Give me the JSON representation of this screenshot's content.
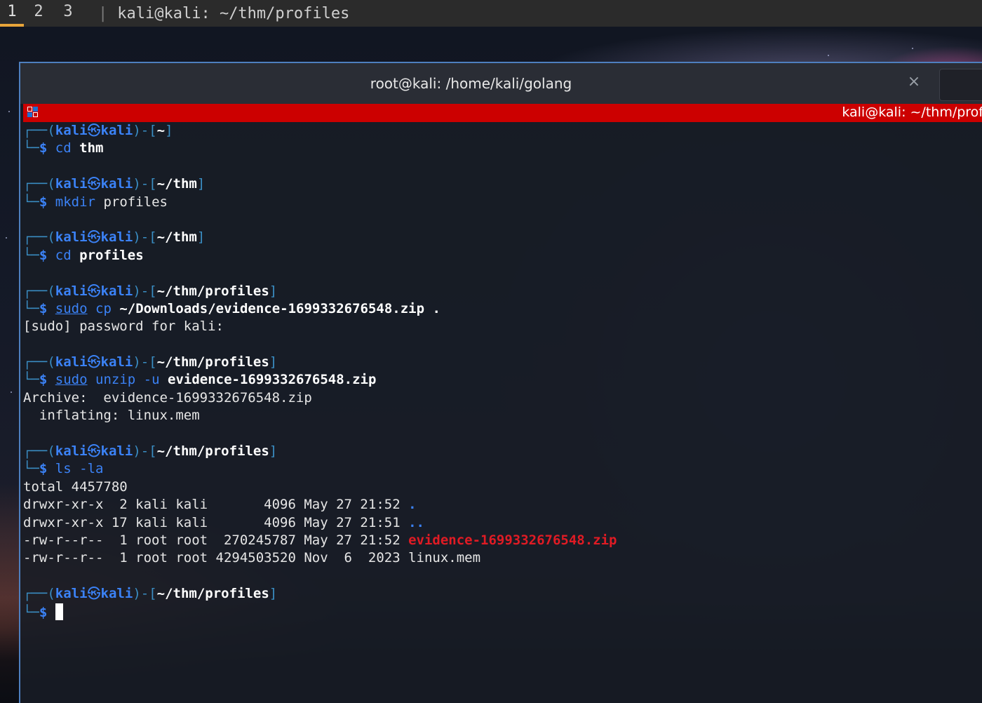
{
  "topbar": {
    "workspaces": [
      "1",
      "2",
      "3"
    ],
    "separator": "|",
    "title": "kali@kali: ~/thm/profiles"
  },
  "window": {
    "title": "root@kali: /home/kali/golang",
    "close_glyph": "×",
    "tab_label": "kali@kali: ~/thm/prof",
    "tab_color": "#cc0000"
  },
  "prompt": {
    "top_left": "┌──(",
    "user": "kali",
    "skull": "㉿",
    "host": "kali",
    "mid": ")-[",
    "close": "]",
    "bottom_left": "└─",
    "dollar": "$"
  },
  "blocks": [
    {
      "path": "~",
      "cmd": [
        {
          "t": "cd",
          "c": "cmd"
        },
        {
          "t": " "
        },
        {
          "t": "thm",
          "c": "arg"
        }
      ],
      "output": []
    },
    {
      "path": "~/thm",
      "cmd": [
        {
          "t": "mkdir",
          "c": "cmd"
        },
        {
          "t": " profiles",
          "c": "out"
        }
      ],
      "output": []
    },
    {
      "path": "~/thm",
      "cmd": [
        {
          "t": "cd",
          "c": "cmd"
        },
        {
          "t": " "
        },
        {
          "t": "profiles",
          "c": "arg"
        }
      ],
      "output": []
    },
    {
      "path": "~/thm/profiles",
      "cmd": [
        {
          "t": "sudo",
          "c": "sudo"
        },
        {
          "t": " "
        },
        {
          "t": "cp",
          "c": "cmd"
        },
        {
          "t": " "
        },
        {
          "t": "~/Downloads/evidence-1699332676548.zip .",
          "c": "arg"
        }
      ],
      "output": [
        "[sudo] password for kali:"
      ]
    },
    {
      "path": "~/thm/profiles",
      "cmd": [
        {
          "t": "sudo",
          "c": "sudo"
        },
        {
          "t": " "
        },
        {
          "t": "unzip",
          "c": "cmd"
        },
        {
          "t": " "
        },
        {
          "t": "-u",
          "c": "flag"
        },
        {
          "t": " "
        },
        {
          "t": "evidence-1699332676548.zip",
          "c": "arg"
        }
      ],
      "output": [
        "Archive:  evidence-1699332676548.zip",
        "  inflating: linux.mem"
      ]
    },
    {
      "path": "~/thm/profiles",
      "cmd": [
        {
          "t": "ls",
          "c": "cmd"
        },
        {
          "t": " "
        },
        {
          "t": "-la",
          "c": "flag"
        }
      ],
      "output": [
        "total 4457780"
      ],
      "listing": [
        {
          "perm": "drwxr-xr-x  2 kali kali       4096 May 27 21:52 ",
          "name": ".",
          "kind": "dir"
        },
        {
          "perm": "drwxr-xr-x 17 kali kali       4096 May 27 21:51 ",
          "name": "..",
          "kind": "dir"
        },
        {
          "perm": "-rw-r--r--  1 root root  270245787 May 27 21:52 ",
          "name": "evidence-1699332676548.zip",
          "kind": "zip"
        },
        {
          "perm": "-rw-r--r--  1 root root 4294503520 Nov  6  2023 ",
          "name": "linux.mem",
          "kind": "out"
        }
      ]
    },
    {
      "path": "~/thm/profiles",
      "cmd": [],
      "output": [],
      "cursor": true
    }
  ]
}
